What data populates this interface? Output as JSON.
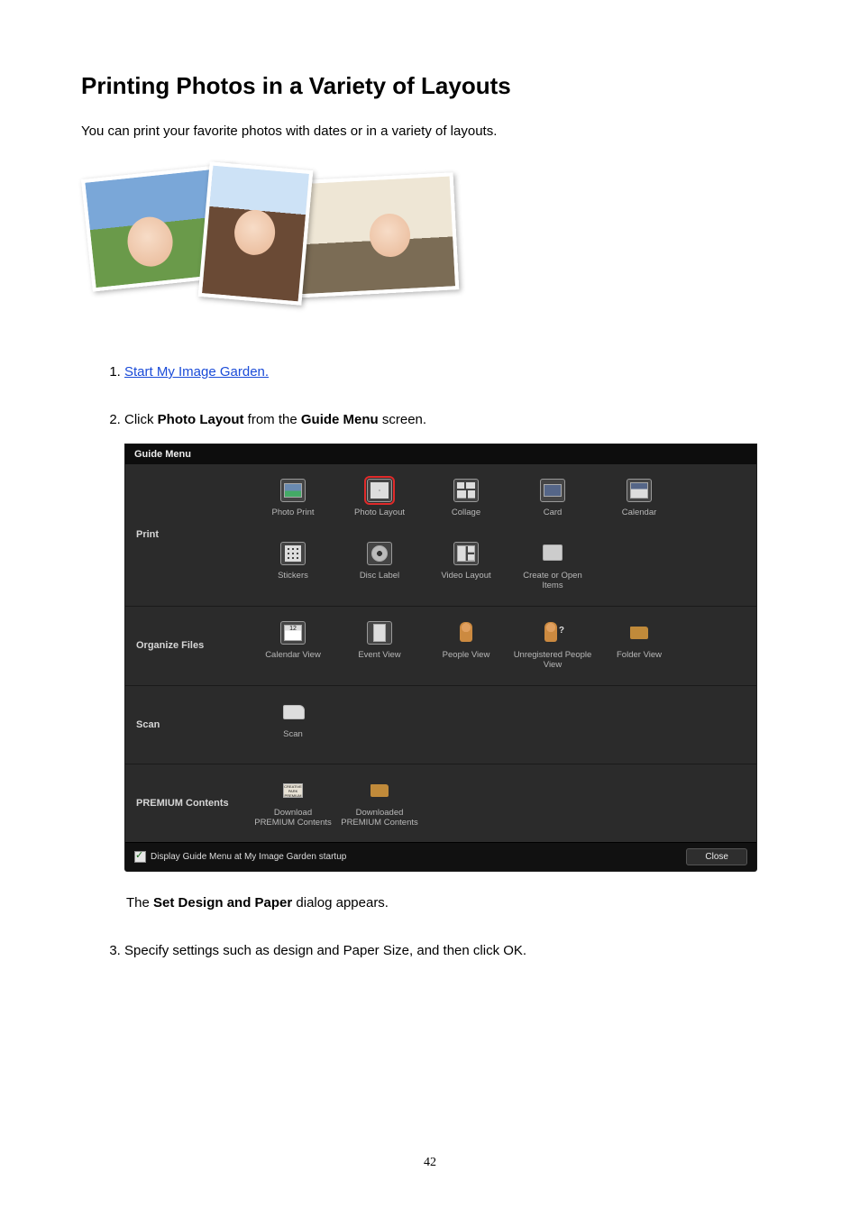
{
  "page": {
    "title": "Printing Photos in a Variety of Layouts",
    "intro": "You can print your favorite photos with dates or in a variety of layouts.",
    "number": "42"
  },
  "steps": {
    "s1_link": "Start My Image Garden.",
    "s2_prefix": "Click ",
    "s2_bold1": "Photo Layout",
    "s2_mid": " from the ",
    "s2_bold2": "Guide Menu",
    "s2_suffix": " screen.",
    "s2_note_prefix": "The ",
    "s2_note_bold": "Set Design and Paper",
    "s2_note_suffix": " dialog appears.",
    "s3": "Specify settings such as design and Paper Size, and then click OK."
  },
  "guide_menu": {
    "title": "Guide Menu",
    "categories": {
      "print": "Print",
      "organize": "Organize Files",
      "scan": "Scan",
      "premium": "PREMIUM Contents"
    },
    "items": {
      "photo_print": "Photo Print",
      "photo_layout": "Photo Layout",
      "collage": "Collage",
      "card": "Card",
      "calendar": "Calendar",
      "stickers": "Stickers",
      "disc_label": "Disc Label",
      "video_layout": "Video Layout",
      "create_open": "Create or Open Items",
      "calendar_view": "Calendar View",
      "event_view": "Event View",
      "people_view": "People View",
      "unregistered": "Unregistered People View",
      "folder_view": "Folder View",
      "scan": "Scan",
      "download_premium": "Download PREMIUM Contents",
      "downloaded_premium": "Downloaded PREMIUM Contents"
    },
    "footer_checkbox": "Display Guide Menu at My Image Garden startup",
    "close": "Close"
  }
}
